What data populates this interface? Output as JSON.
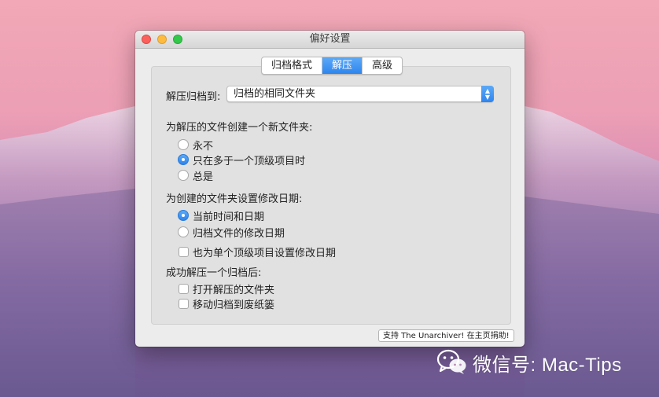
{
  "window": {
    "title": "偏好设置"
  },
  "tabs": [
    {
      "label": "归档格式",
      "active": false
    },
    {
      "label": "解压",
      "active": true
    },
    {
      "label": "高级",
      "active": false
    }
  ],
  "extract_to": {
    "label": "解压归档到:",
    "value": "归档的相同文件夹"
  },
  "new_folder": {
    "label": "为解压的文件创建一个新文件夹:",
    "options": [
      {
        "label": "永不",
        "selected": false
      },
      {
        "label": "只在多于一个顶级项目时",
        "selected": true
      },
      {
        "label": "总是",
        "selected": false
      }
    ]
  },
  "mod_date": {
    "label": "为创建的文件夹设置修改日期:",
    "options": [
      {
        "label": "当前时间和日期",
        "selected": true
      },
      {
        "label": "归档文件的修改日期",
        "selected": false
      }
    ],
    "single_item": {
      "label": "也为单个顶级项目设置修改日期",
      "checked": false
    }
  },
  "after_extract": {
    "label": "成功解压一个归档后:",
    "open_folder": {
      "label": "打开解压的文件夹",
      "checked": false
    },
    "move_to_trash": {
      "label": "移动归档到废纸篓",
      "checked": false
    }
  },
  "support_button": "支持 The Unarchiver! 在主页捐助!",
  "watermark": {
    "text": "微信号: Mac-Tips",
    "icon": "wechat-icon"
  },
  "colors": {
    "accent": "#2f85ee",
    "close": "#fc605c",
    "minimize": "#fdbc40",
    "maximize": "#34c84a"
  }
}
